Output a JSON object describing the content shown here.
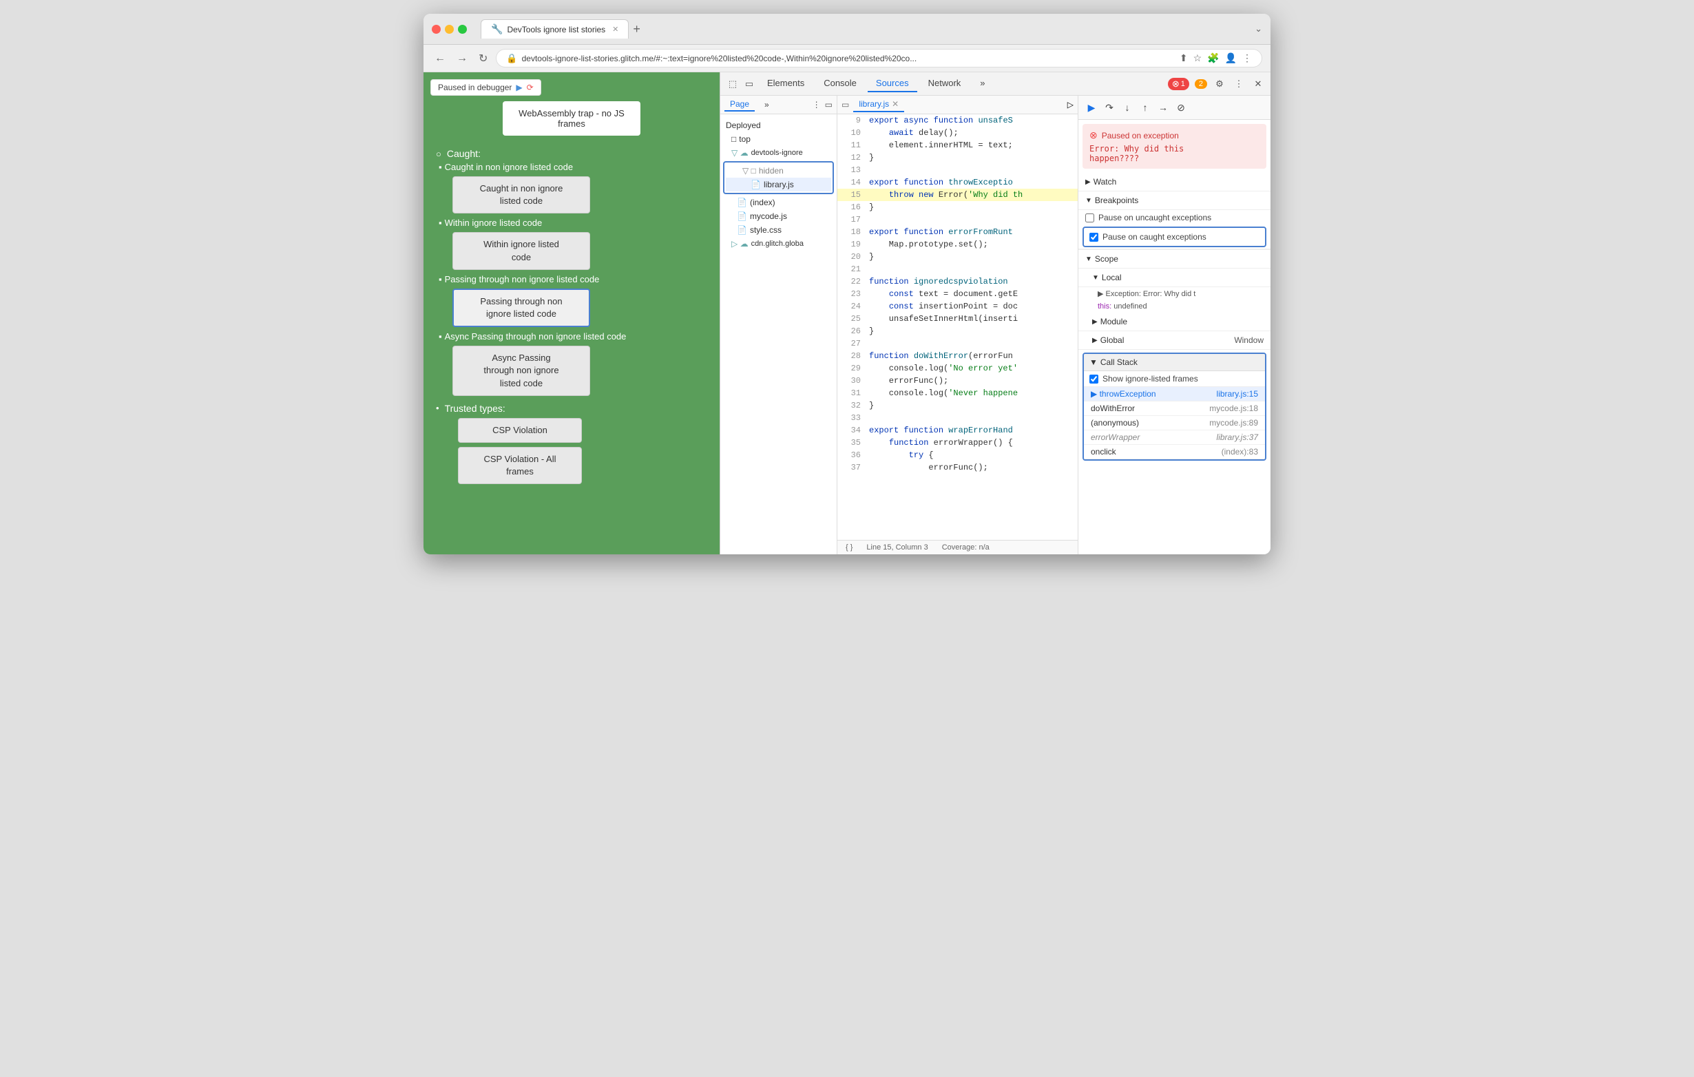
{
  "browser": {
    "title": "DevTools ignore list stories",
    "tab_label": "DevTools ignore list stories",
    "address": "devtools-ignore-list-stories.glitch.me/#:~:text=ignore%20listed%20code-,Within%20ignore%20listed%20co...",
    "new_tab_icon": "+",
    "chevron_icon": "⌄"
  },
  "left_panel": {
    "paused_label": "Paused in debugger",
    "webassembly_label": "WebAssembly trap - no JS frames",
    "caught_label": "Caught:",
    "items": [
      {
        "label": "Caught in non ignore listed code",
        "button": "Caught in non ignore\nlisted code",
        "active": false
      },
      {
        "label": "Within ignore listed code",
        "button": "Within ignore listed\ncode",
        "active": false
      },
      {
        "label": "Passing through non ignore listed code",
        "button": "Passing through non\nignore listed code",
        "active": true
      },
      {
        "label": "Async Passing through non ignore listed code",
        "button": "Async Passing\nthrough non ignore\nlisted code",
        "active": false
      }
    ],
    "trusted_types_label": "Trusted types:",
    "csp_violation_label": "CSP Violation",
    "csp_all_frames_label": "CSP Violation - All frames"
  },
  "devtools": {
    "tabs": [
      "Elements",
      "Console",
      "Sources",
      "Network"
    ],
    "active_tab": "Sources",
    "error_count": "1",
    "warning_count": "2",
    "icons": [
      "cursor-icon",
      "device-icon"
    ],
    "settings_icon": "⚙",
    "more_icon": "⋮",
    "close_icon": "✕"
  },
  "sources": {
    "sub_tabs": [
      "Page",
      "»"
    ],
    "active_file": "library.js",
    "file_tree": {
      "items": [
        {
          "label": "Deployed",
          "type": "header",
          "indent": 0
        },
        {
          "label": "top",
          "type": "folder",
          "indent": 1
        },
        {
          "label": "devtools-ignore",
          "type": "cloud-folder",
          "indent": 1
        },
        {
          "label": "hidden",
          "type": "folder",
          "indent": 2,
          "highlighted": true
        },
        {
          "label": "library.js",
          "type": "js",
          "indent": 3,
          "selected": true
        },
        {
          "label": "(index)",
          "type": "html",
          "indent": 2
        },
        {
          "label": "mycode.js",
          "type": "js",
          "indent": 2
        },
        {
          "label": "style.css",
          "type": "css",
          "indent": 2
        },
        {
          "label": "cdn.glitch.globa",
          "type": "cloud-folder",
          "indent": 1
        }
      ]
    },
    "code_lines": [
      {
        "num": 9,
        "text": "export async function unsafeS",
        "highlight": false
      },
      {
        "num": 10,
        "text": "    await delay();",
        "highlight": false
      },
      {
        "num": 11,
        "text": "    element.innerHTML = text;",
        "highlight": false
      },
      {
        "num": 12,
        "text": "}",
        "highlight": false
      },
      {
        "num": 13,
        "text": "",
        "highlight": false
      },
      {
        "num": 14,
        "text": "export function throwExceptio",
        "highlight": false
      },
      {
        "num": 15,
        "text": "    throw new Error('Why did th",
        "highlight": true
      },
      {
        "num": 16,
        "text": "}",
        "highlight": false
      },
      {
        "num": 17,
        "text": "",
        "highlight": false
      },
      {
        "num": 18,
        "text": "export function errorFromRunt",
        "highlight": false
      },
      {
        "num": 19,
        "text": "    Map.prototype.set();",
        "highlight": false
      },
      {
        "num": 20,
        "text": "}",
        "highlight": false
      },
      {
        "num": 21,
        "text": "",
        "highlight": false
      },
      {
        "num": 22,
        "text": "function ignoredcspviolation",
        "highlight": false
      },
      {
        "num": 23,
        "text": "    const text = document.getE",
        "highlight": false
      },
      {
        "num": 24,
        "text": "    const insertionPoint = doc",
        "highlight": false
      },
      {
        "num": 25,
        "text": "    unsafeSetInnerHtml(inserti",
        "highlight": false
      },
      {
        "num": 26,
        "text": "}",
        "highlight": false
      },
      {
        "num": 27,
        "text": "",
        "highlight": false
      },
      {
        "num": 28,
        "text": "function doWithError(errorFun",
        "highlight": false
      },
      {
        "num": 29,
        "text": "    console.log('No error yet'",
        "highlight": false
      },
      {
        "num": 30,
        "text": "    errorFunc();",
        "highlight": false
      },
      {
        "num": 31,
        "text": "    console.log('Never happene",
        "highlight": false
      },
      {
        "num": 32,
        "text": "}",
        "highlight": false
      },
      {
        "num": 33,
        "text": "",
        "highlight": false
      },
      {
        "num": 34,
        "text": "export function wrapErrorHand",
        "highlight": false
      },
      {
        "num": 35,
        "text": "    function errorWrapper() {",
        "highlight": false
      },
      {
        "num": 36,
        "text": "        try {",
        "highlight": false
      },
      {
        "num": 37,
        "text": "            errorFunc();",
        "highlight": false
      }
    ],
    "status_bar": {
      "line_col": "Line 15, Column 3",
      "coverage": "Coverage: n/a"
    }
  },
  "debugger": {
    "exception_title": "Paused on exception",
    "exception_msg": "Error: Why did this\nhappen????",
    "sections": {
      "watch_label": "Watch",
      "breakpoints_label": "Breakpoints",
      "pause_uncaught_label": "Pause on uncaught exceptions",
      "pause_caught_label": "Pause on caught exceptions",
      "scope_label": "Scope",
      "local_label": "Local",
      "module_label": "Module",
      "global_label": "Global",
      "global_val": "Window",
      "call_stack_label": "Call Stack"
    },
    "local_items": [
      {
        "key": "Exception: Error: Why did t",
        "val": ""
      },
      {
        "key": "this:",
        "val": "undefined"
      }
    ],
    "call_stack": {
      "show_ignore_label": "Show ignore-listed frames",
      "items": [
        {
          "fn": "throwException",
          "file": "library.js:15",
          "active": true,
          "dimmed": false
        },
        {
          "fn": "doWithError",
          "file": "mycode.js:18",
          "active": false,
          "dimmed": false
        },
        {
          "fn": "(anonymous)",
          "file": "mycode.js:89",
          "active": false,
          "dimmed": false
        },
        {
          "fn": "errorWrapper",
          "file": "library.js:37",
          "active": false,
          "dimmed": true
        },
        {
          "fn": "onclick",
          "file": "(index):83",
          "active": false,
          "dimmed": false
        }
      ]
    }
  }
}
